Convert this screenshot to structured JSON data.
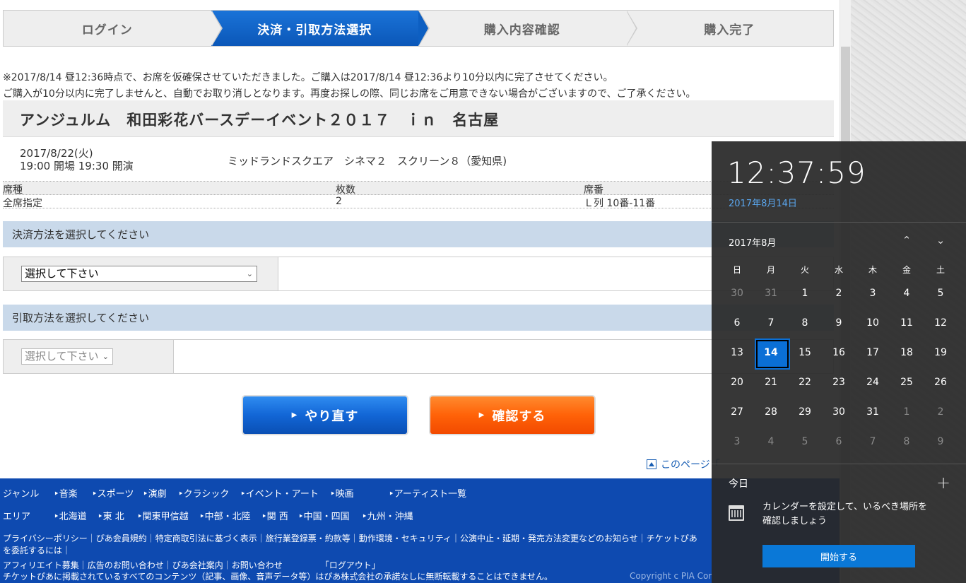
{
  "steps": [
    {
      "label": "ログイン",
      "active": false
    },
    {
      "label": "決済・引取方法選択",
      "active": true
    },
    {
      "label": "購入内容確認",
      "active": false
    },
    {
      "label": "購入完了",
      "active": false
    }
  ],
  "notice": {
    "line1": "※2017/8/14 昼12:36時点で、お席を仮確保させていただきました。ご購入は2017/8/14 昼12:36より10分以内に完了させてください。",
    "line2": "ご購入が10分以内に完了しませんと、自動でお取り消しとなります。再度お探しの際、同じお席をご用意できない場合がございますので、ご了承ください。"
  },
  "event": {
    "title": "アンジュルム　和田彩花バースデーイベント２０１７　ｉｎ　名古屋",
    "date_line1": "2017/8/22(火)",
    "date_line2": "19:00 開場  19:30 開演",
    "venue": "ミッドランドスクエア　シネマ２　スクリーン８（愛知県)"
  },
  "seats": {
    "headers": [
      "席種",
      "枚数",
      "席番"
    ],
    "row": [
      "全席指定",
      "2",
      "Ｌ列 10番-11番"
    ]
  },
  "payment": {
    "heading": "決済方法を選択してください",
    "select_value": "選択して下さい"
  },
  "pickup": {
    "heading": "引取方法を選択してください",
    "select_value": "選択して下さい"
  },
  "buttons": {
    "retry": "やり直す",
    "confirm": "確認する"
  },
  "page_top": "このページ「",
  "footer": {
    "genre_caption": "ジャンル",
    "genres": [
      "音楽",
      "スポーツ",
      "演劇",
      "クラシック",
      "イベント・アート",
      "映画",
      "アーティスト一覧"
    ],
    "area_caption": "エリア",
    "areas": [
      "北海道",
      "東 北",
      "関東甲信越",
      "中部・北陸",
      "関 西",
      "中国・四国",
      "九州・沖縄"
    ],
    "policy_line1": "プライバシーポリシー｜ぴあ会員規約｜特定商取引法に基づく表示｜旅行業登録票・約款等｜動作環境・セキュリティ｜公演中止・延期・発売方法変更などのお知らせ｜チケットぴあ",
    "policy_line2": "を委託するには｜",
    "policy_line3": "アフィリエイト募集｜広告のお問い合わせ｜ぴあ会社案内｜お問い合わせ　　　　　「ログアウト」",
    "policy_line4": "チケットぴあに掲載されているすべてのコンテンツ（記事、画像、音声データ等）はぴあ株式会社の承諾なしに無断転載することはできません。",
    "copyright": "Copyright c PIA Cor"
  },
  "calendar_flyout": {
    "time": "12:37:59",
    "date": "2017年8月14日",
    "month": "2017年8月",
    "weekdays": [
      "日",
      "月",
      "火",
      "水",
      "木",
      "金",
      "土"
    ],
    "weeks": [
      [
        "30",
        "31",
        "1",
        "2",
        "3",
        "4",
        "5"
      ],
      [
        "6",
        "7",
        "8",
        "9",
        "10",
        "11",
        "12"
      ],
      [
        "13",
        "14",
        "15",
        "16",
        "17",
        "18",
        "19"
      ],
      [
        "20",
        "21",
        "22",
        "23",
        "24",
        "25",
        "26"
      ],
      [
        "27",
        "28",
        "29",
        "30",
        "31",
        "1",
        "2"
      ],
      [
        "3",
        "4",
        "5",
        "6",
        "7",
        "8",
        "9"
      ]
    ],
    "today": "14",
    "today_label": "今日",
    "add_icon": "plus-icon",
    "message_line1": "カレンダーを設定して、いるべき場所を",
    "message_line2": "確認しましょう",
    "start_button": "開始する",
    "accent_color": "#0a78d7"
  }
}
